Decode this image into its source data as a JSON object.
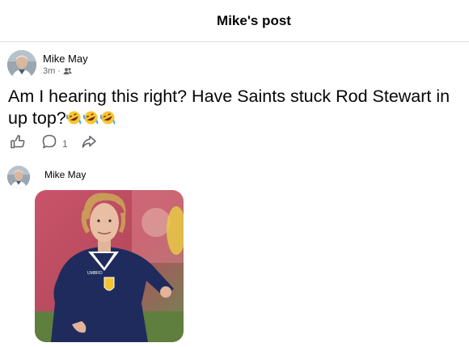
{
  "header": {
    "title": "Mike's post"
  },
  "post": {
    "author": "Mike May",
    "time": "3m",
    "separator": "·",
    "audience_icon": "friends-icon",
    "text": "Am I hearing this right? Have Saints stuck Rod Stewart in up top?",
    "emojis": [
      "rolling-on-floor-laughing-emoji",
      "rolling-on-floor-laughing-emoji",
      "rolling-on-floor-laughing-emoji"
    ],
    "comment_count": "1"
  },
  "comment": {
    "author": "Mike May",
    "image": "photo-of-footballer-in-navy-scotland-kit"
  },
  "colors": {
    "text": "#050505",
    "secondary_text": "#65676b",
    "divider": "#dcdfe3",
    "kit_navy": "#1f2b5c"
  }
}
